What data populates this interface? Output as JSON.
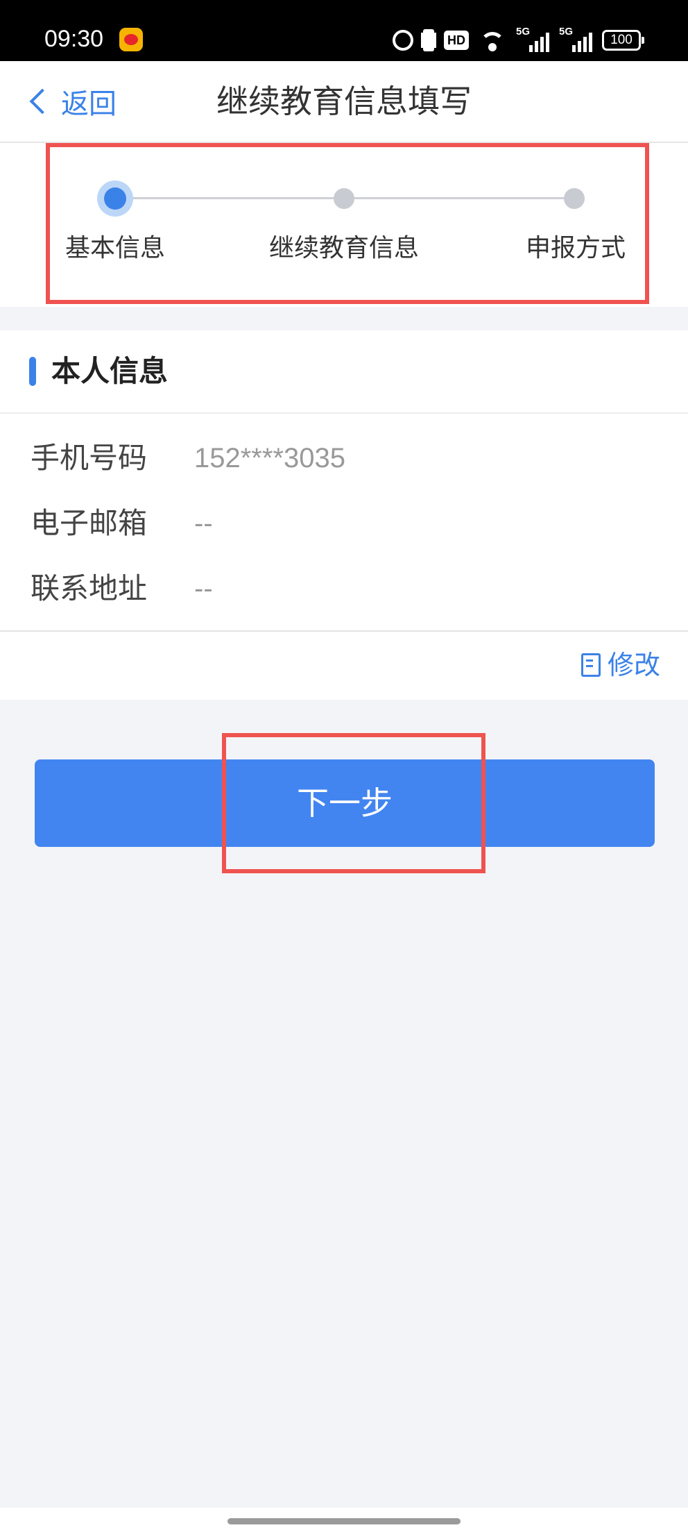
{
  "status_bar": {
    "time": "09:30",
    "icons": [
      "weibo-icon",
      "alarm-icon",
      "vibrate-icon",
      "hd-icon",
      "wifi-icon",
      "signal-5g-icon",
      "signal-5g-icon",
      "battery-icon"
    ],
    "hd_label": "HD",
    "signal_label": "5G",
    "battery": "100"
  },
  "nav": {
    "back_label": "返回",
    "title": "继续教育信息填写"
  },
  "stepper": {
    "steps": [
      {
        "label": "基本信息",
        "active": true
      },
      {
        "label": "继续教育信息",
        "active": false
      },
      {
        "label": "申报方式",
        "active": false
      }
    ]
  },
  "personal_info": {
    "section_title": "本人信息",
    "rows": [
      {
        "label": "手机号码",
        "value": "152****3035"
      },
      {
        "label": "电子邮箱",
        "value": "--"
      },
      {
        "label": "联系地址",
        "value": "--"
      }
    ],
    "edit_label": "修改"
  },
  "actions": {
    "next_label": "下一步"
  },
  "colors": {
    "accent": "#3b82e8",
    "button": "#4285f0",
    "highlight": "#ef5350",
    "background": "#f3f4f8"
  }
}
